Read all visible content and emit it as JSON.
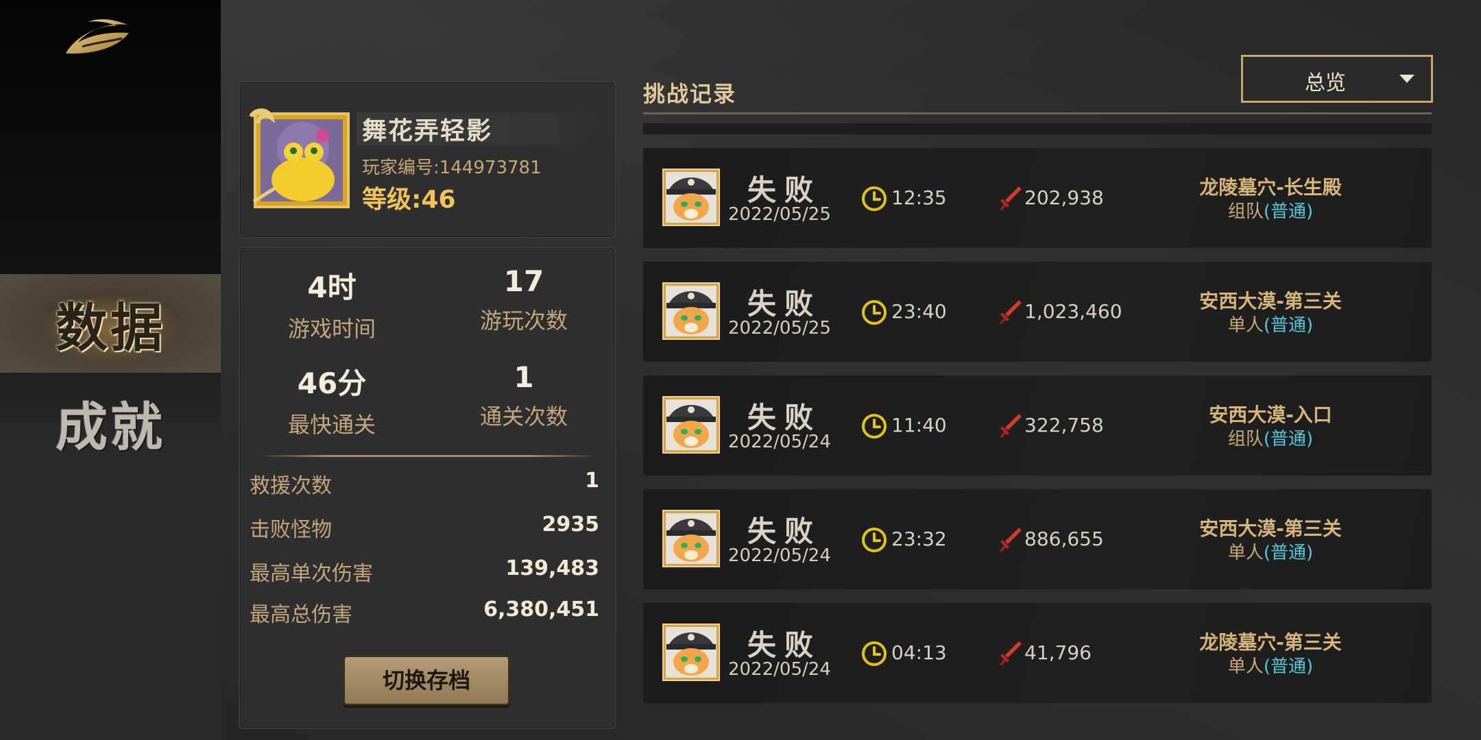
{
  "sidebar": {
    "logo_icon": "golden-swirl-logo-icon",
    "items": [
      {
        "label": "数据",
        "active": true
      },
      {
        "label": "成就",
        "active": false
      }
    ]
  },
  "profile": {
    "name": "舞花弄轻影",
    "player_id": "玩家编号:144973781",
    "level": "等级:46"
  },
  "stats": {
    "cells": [
      {
        "value": "4时",
        "label": "游戏时间"
      },
      {
        "value": "17",
        "label": "游玩次数"
      },
      {
        "value": "46分",
        "label": "最快通关"
      },
      {
        "value": "1",
        "label": "通关次数"
      }
    ],
    "rows": [
      {
        "key": "救援次数",
        "value": "1"
      },
      {
        "key": "击败怪物",
        "value": "2935"
      },
      {
        "key": "最高单次伤害",
        "value": "139,483"
      },
      {
        "key": "最高总伤害",
        "value": "6,380,451"
      }
    ],
    "switch_button": "切换存档"
  },
  "records": {
    "title": "挑战记录",
    "filter": {
      "selected": "总览"
    },
    "items": [
      {
        "result": "失败",
        "date": "2022/05/25",
        "time": "12:35",
        "damage": "202,938",
        "stage": "龙陵墓穴-长生殿",
        "mode": "组队",
        "difficulty": "(普通)"
      },
      {
        "result": "失败",
        "date": "2022/05/25",
        "time": "23:40",
        "damage": "1,023,460",
        "stage": "安西大漠-第三关",
        "mode": "单人",
        "difficulty": "(普通)"
      },
      {
        "result": "失败",
        "date": "2022/05/24",
        "time": "11:40",
        "damage": "322,758",
        "stage": "安西大漠-入口",
        "mode": "组队",
        "difficulty": "(普通)"
      },
      {
        "result": "失败",
        "date": "2022/05/24",
        "time": "23:32",
        "damage": "886,655",
        "stage": "安西大漠-第三关",
        "mode": "单人",
        "difficulty": "(普通)"
      },
      {
        "result": "失败",
        "date": "2022/05/24",
        "time": "04:13",
        "damage": "41,796",
        "stage": "龙陵墓穴-第三关",
        "mode": "单人",
        "difficulty": "(普通)"
      }
    ]
  },
  "colors": {
    "accent_gold": "#c9a96a",
    "level_gold": "#f0c45a",
    "difficulty_cyan": "#57c8d8",
    "damage_red": "#d23a2a"
  }
}
